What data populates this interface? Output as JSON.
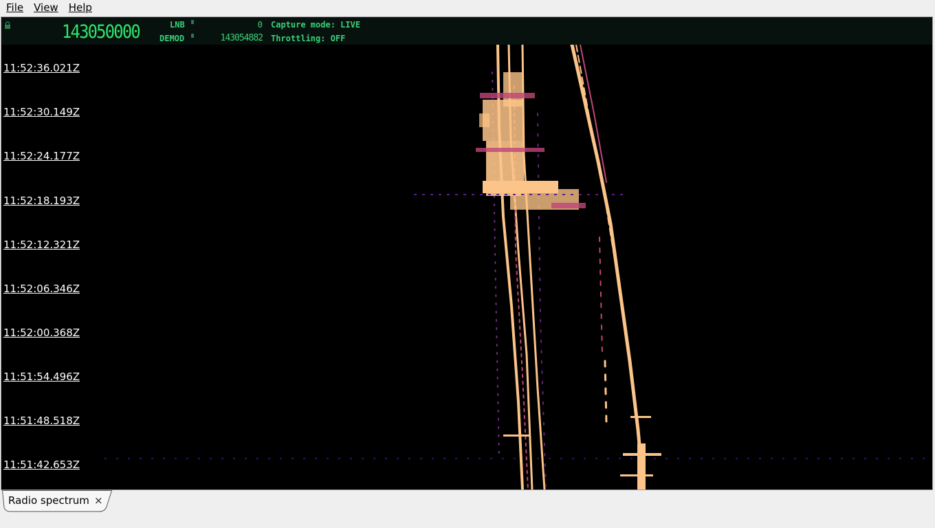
{
  "menubar": {
    "items": [
      "File",
      "View",
      "Help"
    ]
  },
  "header": {
    "frequency_display": "143050000",
    "lnb_label": "LNB",
    "lnb_value": "0",
    "demod_label": "DEMOD",
    "demod_value": "143054882",
    "capture_mode": "Capture mode: LIVE",
    "throttling": "Throttling: OFF"
  },
  "waterfall": {
    "timestamps": [
      "11:52:36.021Z",
      "11:52:30.149Z",
      "11:52:24.177Z",
      "11:52:18.193Z",
      "11:52:12.321Z",
      "11:52:06.346Z",
      "11:52:00.368Z",
      "11:51:54.496Z",
      "11:51:48.518Z",
      "11:51:42.653Z"
    ],
    "colors": {
      "background": "#000000",
      "signal_hot": "#fcc488",
      "signal_mid": "#c0457a",
      "signal_low": "#5a1f8a"
    }
  },
  "tabs": [
    {
      "label": "Radio spectrum",
      "close": "×"
    }
  ]
}
